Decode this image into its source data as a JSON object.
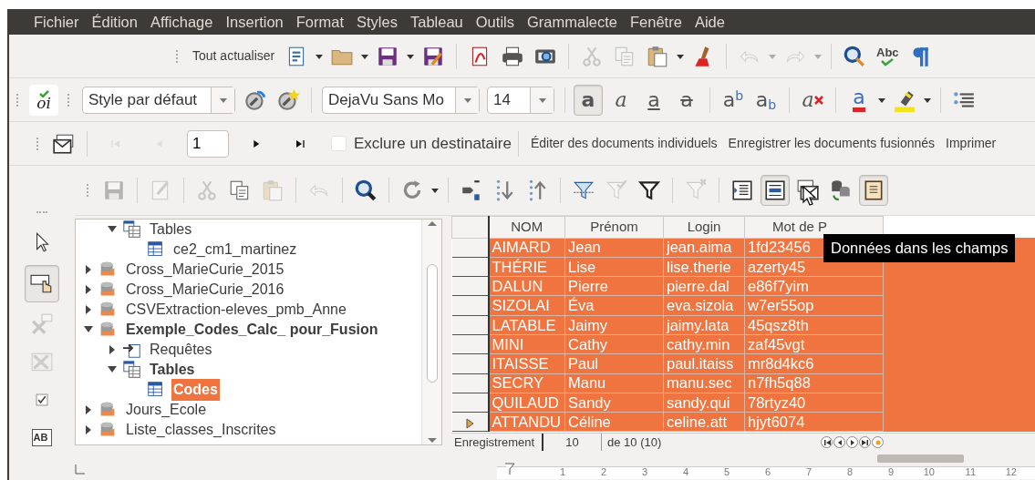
{
  "menu": [
    "Fichier",
    "Édition",
    "Affichage",
    "Insertion",
    "Format",
    "Styles",
    "Tableau",
    "Outils",
    "Grammalecte",
    "Fenêtre",
    "Aide"
  ],
  "standard_toolbar": {
    "refresh_all": "Tout actualiser",
    "buttons": [
      {
        "disabled": false,
        "dropdown": true
      },
      {
        "disabled": false,
        "dropdown": true
      },
      {
        "disabled": false,
        "dropdown": true
      },
      {
        "disabled": false,
        "dropdown": false
      },
      {
        "disabled": false,
        "dropdown": false
      },
      {
        "disabled": false,
        "dropdown": false
      },
      {
        "disabled": false,
        "dropdown": false
      },
      {
        "disabled": true,
        "dropdown": false
      },
      {
        "disabled": true,
        "dropdown": false
      },
      {
        "disabled": false,
        "dropdown": true
      },
      {
        "disabled": false,
        "dropdown": false
      },
      {
        "disabled": true,
        "dropdown": true
      },
      {
        "disabled": true,
        "dropdown": true
      },
      {
        "disabled": false,
        "dropdown": false
      },
      {
        "disabled": false,
        "dropdown": false,
        "glyph": "Abc"
      },
      {
        "disabled": false,
        "dropdown": false
      }
    ]
  },
  "formatting_toolbar": {
    "grammar_logo": "oi",
    "paragraph_style": "Style par défaut",
    "font_name": "DejaVu Sans Mo",
    "font_size": "14",
    "buttons": [
      {
        "kind": "bold",
        "glyph": "a",
        "pressed": true
      },
      {
        "kind": "italic",
        "glyph": "a",
        "pressed": false
      },
      {
        "kind": "underline",
        "glyph": "a",
        "pressed": false
      },
      {
        "kind": "strike",
        "glyph": "a",
        "pressed": false
      },
      {
        "kind": "superscript",
        "glyph": "a$^{b}$",
        "pressed": false
      },
      {
        "kind": "subscript",
        "glyph": "a$_{b}$",
        "pressed": false
      },
      {
        "kind": "clear",
        "glyph": "a",
        "pressed": false
      },
      {
        "kind": "font-color",
        "glyph": "a",
        "color": "#d62828",
        "pressed": false
      },
      {
        "kind": "highlight",
        "color": "#f4e31c",
        "pressed": false
      },
      {
        "kind": "list",
        "pressed": false
      }
    ]
  },
  "mail_merge_toolbar": {
    "nav": [
      {
        "disabled": true
      },
      {
        "disabled": true
      },
      {
        "disabled": false
      },
      {
        "disabled": false
      }
    ],
    "record": "1",
    "exclude": {
      "label": "Exclure un destinataire",
      "checked": false
    },
    "actions": [
      "Éditer des documents individuels",
      "Enregistrer les documents fusionnés",
      "Imprimer"
    ]
  },
  "form_controls_toolbar": {
    "buttons": [
      {
        "disabled": false,
        "pressed": false
      },
      {
        "disabled": false,
        "pressed": true
      },
      {
        "disabled": true,
        "pressed": false
      },
      {
        "disabled": true,
        "pressed": false
      },
      {
        "disabled": false,
        "pressed": false
      },
      {
        "disabled": false,
        "pressed": false,
        "glyph": "AB"
      }
    ]
  },
  "data_toolbar": {
    "buttons": [
      {
        "disabled": true,
        "pressed": false
      },
      {
        "disabled": true,
        "pressed": false
      },
      {
        "disabled": true,
        "pressed": false
      },
      {
        "disabled": false,
        "pressed": false
      },
      {
        "disabled": true,
        "pressed": false
      },
      {
        "disabled": true,
        "pressed": false
      },
      {
        "disabled": false,
        "pressed": false
      },
      {
        "disabled": false,
        "pressed": false,
        "dropdown": true
      },
      {
        "disabled": false,
        "pressed": false
      },
      {
        "disabled": false,
        "pressed": false
      },
      {
        "disabled": false,
        "pressed": false
      },
      {
        "disabled": false,
        "pressed": false
      },
      {
        "disabled": true,
        "pressed": false
      },
      {
        "disabled": false,
        "pressed": false
      },
      {
        "disabled": true,
        "pressed": false
      },
      {
        "disabled": false,
        "pressed": false
      },
      {
        "disabled": false,
        "pressed": true
      },
      {
        "disabled": false,
        "pressed": false
      },
      {
        "disabled": false,
        "pressed": false
      },
      {
        "disabled": false,
        "pressed": true
      }
    ]
  },
  "tree": {
    "items": [
      {
        "children": [
          {
            "kind": "folder",
            "label": "Tables",
            "expanded": true,
            "selected": false,
            "current": false,
            "children": [
              {
                "kind": "table",
                "label": "ce2_cm1_martinez",
                "selected": false,
                "current": false
              }
            ]
          }
        ]
      },
      {
        "kind": "database",
        "label": "Cross_MarieCurie_2015",
        "expanded": false,
        "selected": false,
        "current": false
      },
      {
        "kind": "database",
        "label": "Cross_MarieCurie_2016",
        "expanded": false,
        "selected": false,
        "current": false
      },
      {
        "kind": "database",
        "label": "CSVExtraction-eleves_pmb_Anne",
        "expanded": false,
        "selected": false,
        "current": false
      },
      {
        "kind": "database",
        "label": "Exemple_Codes_Calc_ pour_Fusion",
        "expanded": true,
        "selected": false,
        "current": true,
        "children": [
          {
            "kind": "query",
            "label": "Requêtes",
            "expanded": false,
            "selected": false,
            "current": false
          },
          {
            "kind": "folder",
            "label": "Tables",
            "expanded": true,
            "selected": false,
            "current": true,
            "children": [
              {
                "kind": "table",
                "label": "Codes",
                "selected": true,
                "current": true
              }
            ]
          }
        ]
      },
      {
        "kind": "database",
        "label": "Jours_Ecole",
        "expanded": false,
        "selected": false,
        "current": false
      },
      {
        "kind": "database",
        "label": "Liste_classes_Inscrites",
        "expanded": false,
        "selected": false,
        "current": false
      }
    ]
  },
  "grid": {
    "columns": [
      "NOM",
      "Prénom",
      "Login",
      "Mot de P"
    ],
    "rows": [
      {
        "cells": [
          "AIMARD",
          "Jean",
          "jean.aima",
          "1fd23456"
        ],
        "selected": true,
        "current": false
      },
      {
        "cells": [
          "THÉRIE",
          "Lise",
          "lise.therie",
          "azerty45"
        ],
        "selected": true,
        "current": false
      },
      {
        "cells": [
          "DALUN",
          "Pierre",
          "pierre.dal",
          "e86f7yim"
        ],
        "selected": true,
        "current": false
      },
      {
        "cells": [
          "SIZOLAI",
          "Éva",
          "eva.sizola",
          "w7er55op"
        ],
        "selected": true,
        "current": false
      },
      {
        "cells": [
          "LATABLE",
          "Jaimy",
          "jaimy.lata",
          "45qsz8th"
        ],
        "selected": true,
        "current": false
      },
      {
        "cells": [
          "MINI",
          "Cathy",
          "cathy.min",
          "zaf45vgt"
        ],
        "selected": true,
        "current": false
      },
      {
        "cells": [
          "ITAISSE",
          "Paul",
          "paul.itaiss",
          "mr8d4kc6"
        ],
        "selected": true,
        "current": false
      },
      {
        "cells": [
          "SECRY",
          "Manu",
          "manu.sec",
          "n7fh5q88"
        ],
        "selected": true,
        "current": false
      },
      {
        "cells": [
          "QUILAUD",
          "Sandy",
          "sandy.qui",
          "78rtyz40"
        ],
        "selected": true,
        "current": false
      },
      {
        "cells": [
          "ATTANDU",
          "Céline",
          "celine.att",
          "hjyt6074"
        ],
        "selected": true,
        "current": true
      }
    ]
  },
  "record_bar": {
    "label": "Enregistrement",
    "value": "10",
    "total": "de 10 (10)"
  },
  "tooltip": "Données dans les champs",
  "ruler": {
    "labels": [
      "1",
      "2",
      "3",
      "4",
      "5",
      "6",
      "7",
      "8",
      "9",
      "10",
      "11",
      "12"
    ]
  }
}
